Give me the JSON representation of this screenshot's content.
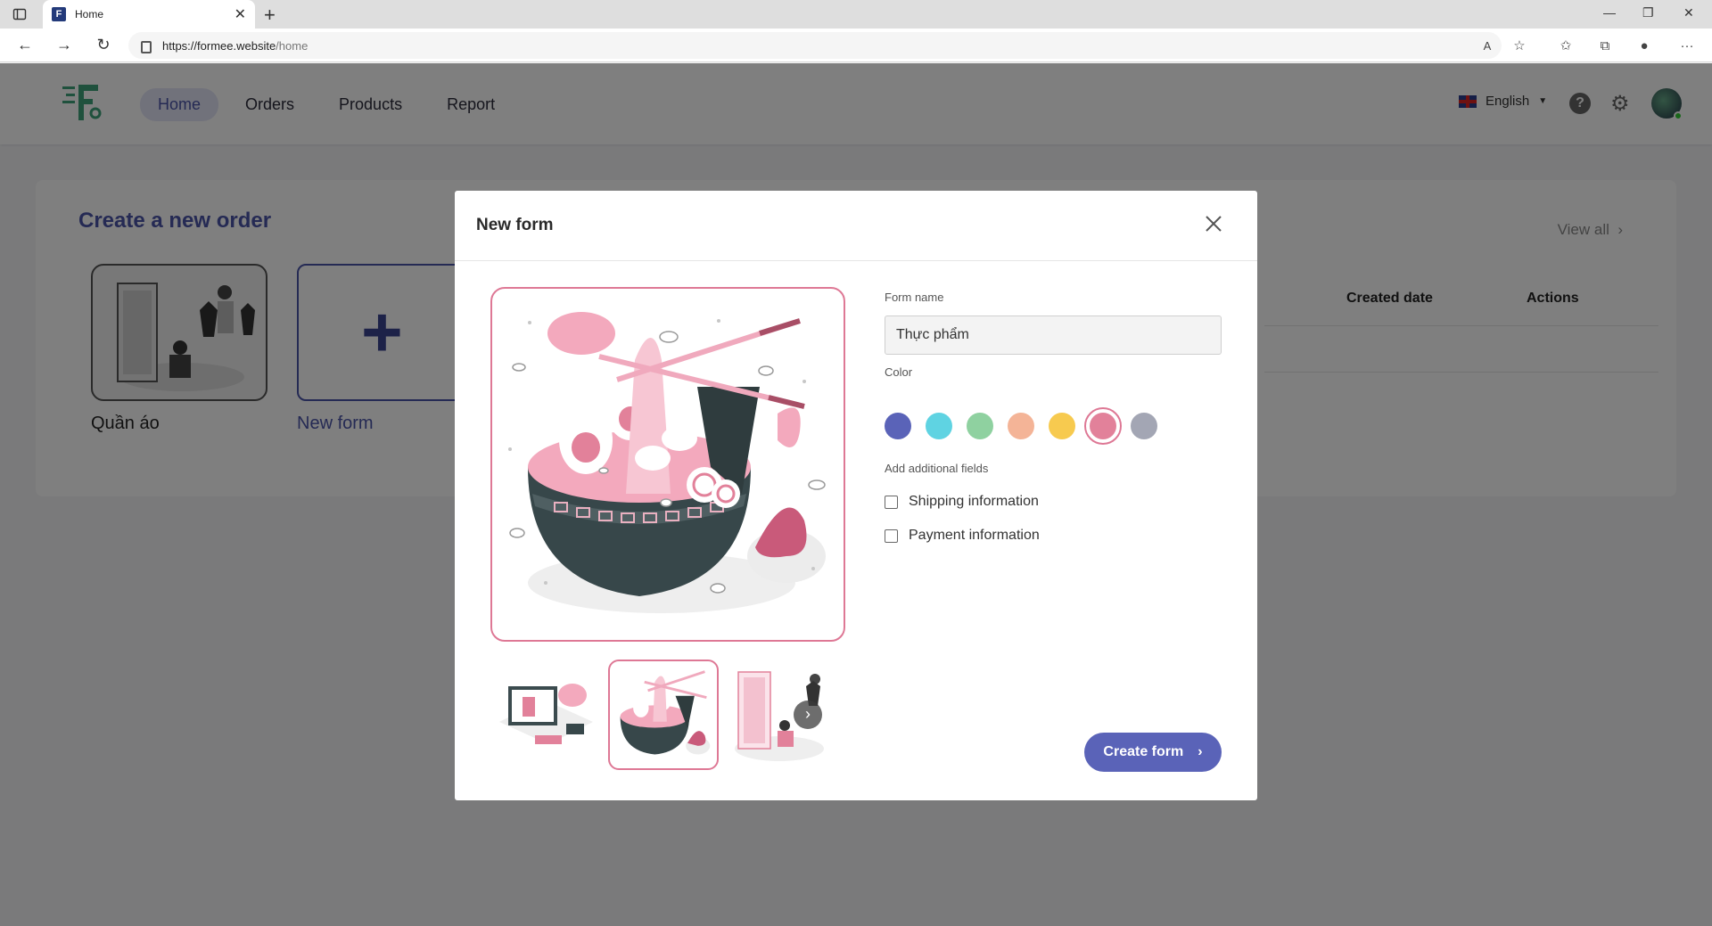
{
  "browser": {
    "tab_title": "Home",
    "favicon_letter": "F",
    "url_host": "https://formee.website",
    "url_path": "/home"
  },
  "nav": {
    "items": [
      {
        "label": "Home",
        "active": true
      },
      {
        "label": "Orders",
        "active": false
      },
      {
        "label": "Products",
        "active": false
      },
      {
        "label": "Report",
        "active": false
      }
    ],
    "language": "English"
  },
  "main": {
    "card_title": "Create a new order",
    "view_all": "View all",
    "tiles": [
      {
        "label": "Quần áo"
      },
      {
        "label": "New form"
      }
    ],
    "columns": [
      "Created date",
      "Actions"
    ]
  },
  "modal": {
    "title": "New form",
    "form_name_label": "Form name",
    "form_name_value": "Thực phẩm",
    "color_label": "Color",
    "colors": [
      "#5a63b8",
      "#5fd3e2",
      "#8fd1a0",
      "#f4b497",
      "#f7ca4f",
      "#e2819a",
      "#a3a6b4"
    ],
    "selected_color": "#e2819a",
    "additional_label": "Add additional fields",
    "fields": [
      {
        "label": "Shipping information",
        "checked": false
      },
      {
        "label": "Payment information",
        "checked": false
      }
    ],
    "create_label": "Create form"
  }
}
